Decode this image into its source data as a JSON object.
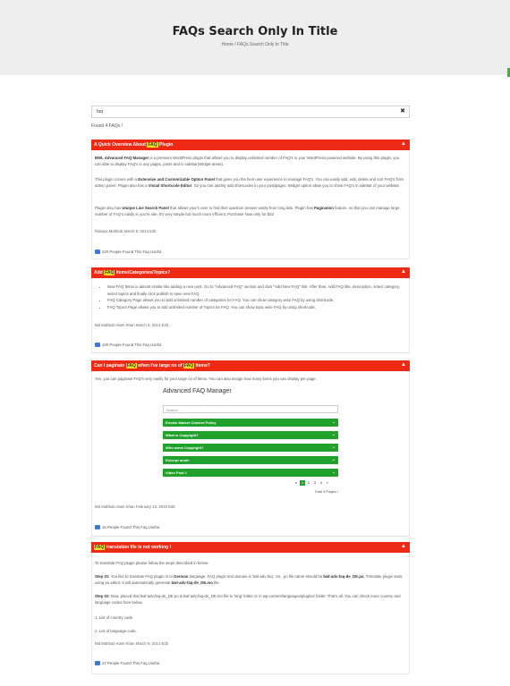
{
  "page": {
    "title": "FAQs Search Only In Title",
    "breadcrumb_home": "Home",
    "breadcrumb_sep": "/",
    "breadcrumb_current": "FAQs Search Only In Title"
  },
  "search": {
    "value": "faq",
    "clear": "✖"
  },
  "found_text": "Found 4 FAQs !",
  "faq1": {
    "pre": "A Quick Overview About ",
    "hl": "FAQ",
    "post": " Plugin",
    "p1a": "BWL Advanced FAQ Manager",
    "p1b": " is a premium WordPress plugin that allows you to display unlimited number of FAQ's in your WordPress powered website. By using this plugin, you can able to display FAQ's in any pages, posts and in sidebar(Widget areas).",
    "p2a": "This plugin comes with a ",
    "p2b": "Extensive and Customizable Option Panel",
    "p2c": " that gives you the best user experience to manage FAQ's. You can easily add, edit, delete and sort FAQ's from admin panel. Plugin also has a ",
    "p2d": "Visual Shortcode Editor",
    "p2e": ". So you can quickly add shortcodes in your post/pages. Widget option allow you to show FAQ's in sidebar of your website.",
    "p3a": "Plugin also has ",
    "p3b": "Unique Live Search Panel",
    "p3c": " that allows your's user to find their question answer easily from long lists. Plugin has ",
    "p3d": "Pagination",
    "p3e": " feature, so that you can manage large number of FAQ's easily in you're site. It's very simple but much more efficient. Purchase Now only for $33",
    "meta": "Rakaya Mahbub  March 9, 2014  Edit",
    "useful": "220 People Found This Faq Useful."
  },
  "faq2": {
    "pre": "Add ",
    "hl": "FAQ",
    "post": " Items/Categories/Topics?",
    "items": [
      "New FAQ Items is almost similar like adding a new post. Go to \"Advanced FAQ\" section and click \"Add New FAQ\" link. After than, Add FAQ title, description, select category, select topics and finally click publish to save new FAQ.",
      "FAQ Category Page allows you to add unlimited number of categories for FAQ. You can show category wise FAQ by using shortcode.",
      "FAQ Topics Page allows you to add unlimited number of Topics for FAQ. You can show topic wise FAQ by using shortcode."
    ],
    "meta": "Md Mahbub Alam Khan  March 9, 2014  Edit",
    "useful": "100 People Found This Faq Useful."
  },
  "faq3": {
    "pre": "Can I paginate ",
    "hl": "FAQ",
    "mid": " when I've large no of ",
    "hl2": "FAQ",
    "post": " items?",
    "p1": "Yes, you can paginate FAQ's very easily for your large no of items. You can also assign how many items you can display per page.",
    "embed_title": "Advanced FAQ Manager",
    "embed_search": "Search...",
    "embed_items": [
      "Envato Market Content Policy",
      "What is Copyright?",
      "Who owns Copyright?",
      "Excerpt mode",
      "Video Post 1"
    ],
    "embed_pages": [
      "«",
      "1",
      "2",
      "3",
      "4",
      "»"
    ],
    "embed_total": "Total 4 Pages !",
    "meta": "Md Mahbub Alam Khan  February 13, 2015  Edit",
    "useful": "16 People Found This Faq Useful."
  },
  "faq4": {
    "hl": "FAQ",
    "post": " translation file is not working !",
    "p1": "To translate FAQ plugin please follow the steps described in below-",
    "s1a": "Step 01:",
    "s1b": " You like to translate FAQ plugin in to ",
    "s1c": "German",
    "s1d": " language. FAQ plugin text domain is 'bwl-adv-faq'. So, .po file name should be ",
    "s1e": "bwl-adv-faq-de_DE.po",
    "s1f": ". Translate plugin texts using po editor. It will automatically generate ",
    "s1g": "bwl-adv-faq-de_DE.mo",
    "s1h": " file.",
    "s2a": "Step 02:",
    "s2b": " Now, placed that bwl-adv-faq-de_DE.po & bwl-adv-faq-de_DE.mo file in 'lang' folder or in wp-content/languages/plugins/ folder. That's all. You can check more country and language codes from below.",
    "l1": "1. List of country code.",
    "l2": "2. List of language code.",
    "meta": "Md Mahbub Alam Khan  March 9, 2014  Edit",
    "useful": "27 People Found This Faq Useful."
  },
  "toggle_icon": "▲",
  "embed_chevron": "⌄",
  "colors": {
    "bar": "#ee2a14",
    "highlight": "#f7e21b",
    "embed_bar": "#20a12b"
  }
}
